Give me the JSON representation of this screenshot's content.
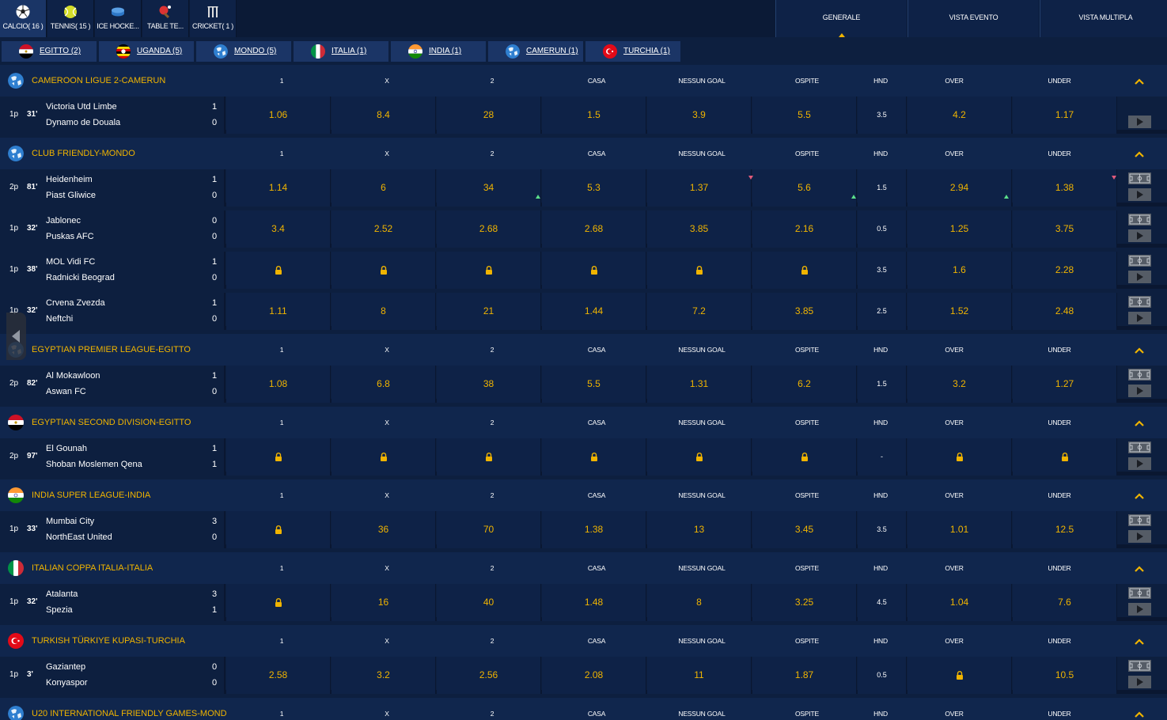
{
  "sports": [
    {
      "label": "CALCIO( 16 )",
      "icon": "soccer-ball-icon",
      "active": true
    },
    {
      "label": "TENNIS( 15 )",
      "icon": "tennis-ball-icon",
      "active": false
    },
    {
      "label": "ICE HOCKE...",
      "icon": "ice-hockey-puck-icon",
      "active": false
    },
    {
      "label": "TABLE TE...",
      "icon": "table-tennis-icon",
      "active": false
    },
    {
      "label": "CRICKET( 1 )",
      "icon": "cricket-icon",
      "active": false
    }
  ],
  "views": [
    {
      "label": "GENERALE",
      "active": true
    },
    {
      "label": "VISTA EVENTO",
      "active": false
    },
    {
      "label": "VISTA MULTIPLA",
      "active": false
    }
  ],
  "countries": [
    {
      "label": "EGITTO  (2)",
      "flag": "egypt"
    },
    {
      "label": "UGANDA  (5)",
      "flag": "uganda"
    },
    {
      "label": "MONDO  (5)",
      "flag": "world"
    },
    {
      "label": "ITALIA  (1)",
      "flag": "italy"
    },
    {
      "label": "INDIA  (1)",
      "flag": "india"
    },
    {
      "label": "CAMERUN  (1)",
      "flag": "world"
    },
    {
      "label": "TURCHIA  (1)",
      "flag": "turkey"
    }
  ],
  "columns": [
    "1",
    "X",
    "2",
    "CASA",
    "NESSUN GOAL",
    "OSPITE",
    "HND",
    "OVER",
    "UNDER"
  ],
  "colors": {
    "accent": "#f0b400",
    "up": "#5be08a",
    "down": "#e05a7a"
  },
  "leagues": [
    {
      "name": "CAMEROON LIGUE 2-CAMERUN",
      "flag": "world",
      "matches": [
        {
          "period": "1p",
          "minute": "31'",
          "home": "Victoria Utd Limbe",
          "away": "Dynamo de Douala",
          "home_score": "1",
          "away_score": "0",
          "odds": [
            "1.06",
            "8.4",
            "28",
            "1.5",
            "3.9",
            "5.5",
            "3.5",
            "4.2",
            "1.17"
          ],
          "stats": false
        }
      ]
    },
    {
      "name": "CLUB FRIENDLY-MONDO",
      "flag": "world",
      "matches": [
        {
          "period": "2p",
          "minute": "81'",
          "home": "Heidenheim",
          "away": "Piast Gliwice",
          "home_score": "1",
          "away_score": "0",
          "odds": [
            "1.14",
            "6",
            "34",
            "5.3",
            "1.37",
            "5.6",
            "1.5",
            "2.94",
            "1.38"
          ],
          "stats": true
        },
        {
          "period": "1p",
          "minute": "32'",
          "home": "Jablonec",
          "away": "Puskas AFC",
          "home_score": "0",
          "away_score": "0",
          "odds": [
            "3.4",
            "2.52",
            "2.68",
            "2.68",
            "3.85",
            "2.16",
            "0.5",
            "1.25",
            "3.75"
          ],
          "stats": true
        },
        {
          "period": "1p",
          "minute": "38'",
          "home": "MOL Vidi FC",
          "away": "Radnicki Beograd",
          "home_score": "1",
          "away_score": "0",
          "odds": [
            "lock",
            "lock",
            "lock",
            "lock",
            "lock",
            "lock",
            "3.5",
            "1.6",
            "2.28"
          ],
          "stats": true
        },
        {
          "period": "1p",
          "minute": "32'",
          "home": "Crvena Zvezda",
          "away": "Neftchi",
          "home_score": "1",
          "away_score": "0",
          "odds": [
            "1.11",
            "8",
            "21",
            "1.44",
            "7.2",
            "3.85",
            "2.5",
            "1.52",
            "2.48"
          ],
          "stats": true
        }
      ]
    },
    {
      "name": "EGYPTIAN PREMIER LEAGUE-EGITTO",
      "flag": "world",
      "matches": [
        {
          "period": "2p",
          "minute": "82'",
          "home": "Al Mokawloon",
          "away": "Aswan FC",
          "home_score": "1",
          "away_score": "0",
          "odds": [
            "1.08",
            "6.8",
            "38",
            "5.5",
            "1.31",
            "6.2",
            "1.5",
            "3.2",
            "1.27"
          ],
          "stats": true
        }
      ]
    },
    {
      "name": "EGYPTIAN SECOND DIVISION-EGITTO",
      "flag": "egypt",
      "matches": [
        {
          "period": "2p",
          "minute": "97'",
          "home": "El Gounah",
          "away": "Shoban Moslemen Qena",
          "home_score": "1",
          "away_score": "1",
          "odds": [
            "lock",
            "lock",
            "lock",
            "lock",
            "lock",
            "lock",
            "-",
            "lock",
            "lock"
          ],
          "stats": true
        }
      ]
    },
    {
      "name": "INDIA SUPER LEAGUE-INDIA",
      "flag": "india",
      "matches": [
        {
          "period": "1p",
          "minute": "33'",
          "home": "Mumbai City",
          "away": "NorthEast United",
          "home_score": "3",
          "away_score": "0",
          "odds": [
            "lock",
            "36",
            "70",
            "1.38",
            "13",
            "3.45",
            "3.5",
            "1.01",
            "12.5"
          ],
          "stats": true
        }
      ]
    },
    {
      "name": "ITALIAN COPPA ITALIA-ITALIA",
      "flag": "italy",
      "matches": [
        {
          "period": "1p",
          "minute": "32'",
          "home": "Atalanta",
          "away": "Spezia",
          "home_score": "3",
          "away_score": "1",
          "odds": [
            "lock",
            "16",
            "40",
            "1.48",
            "8",
            "3.25",
            "4.5",
            "1.04",
            "7.6"
          ],
          "stats": true
        }
      ]
    },
    {
      "name": "TURKISH TÜRKIYE KUPASI-TURCHIA",
      "flag": "turkey",
      "matches": [
        {
          "period": "1p",
          "minute": "3'",
          "home": "Gaziantep",
          "away": "Konyaspor",
          "home_score": "0",
          "away_score": "0",
          "odds": [
            "2.58",
            "3.2",
            "2.56",
            "2.08",
            "11",
            "1.87",
            "0.5",
            "lock",
            "10.5"
          ],
          "stats": true
        }
      ]
    },
    {
      "name": "U20 INTERNATIONAL FRIENDLY GAMES-MOND",
      "flag": "world",
      "matches": []
    }
  ]
}
